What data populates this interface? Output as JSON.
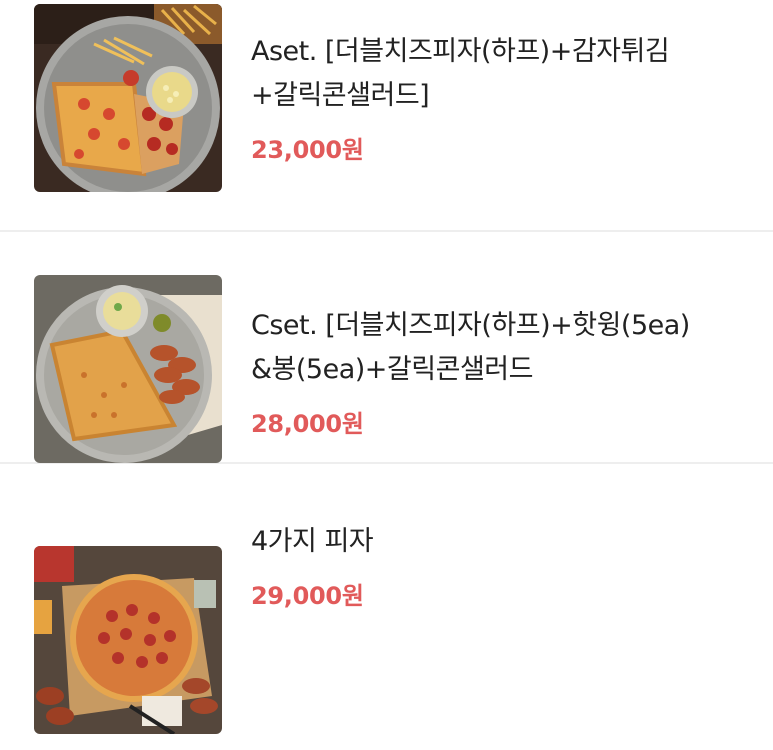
{
  "menu": {
    "items": [
      {
        "name": "Aset. [더블치즈피자(하프)+감자튀김\n+갈릭콘샐러드]",
        "price": "23,000원",
        "image": "pizza-fries-salad-photo"
      },
      {
        "name": "Cset. [더블치즈피자(하프)+핫윙(5ea)\n&봉(5ea)+갈릭콘샐러드",
        "price": "28,000원",
        "image": "pizza-wings-salad-photo"
      },
      {
        "name": "4가지 피자",
        "price": "29,000원",
        "image": "four-pizza-photo"
      }
    ]
  },
  "colors": {
    "price": "#e15a5a",
    "divider": "#eeeeee"
  }
}
